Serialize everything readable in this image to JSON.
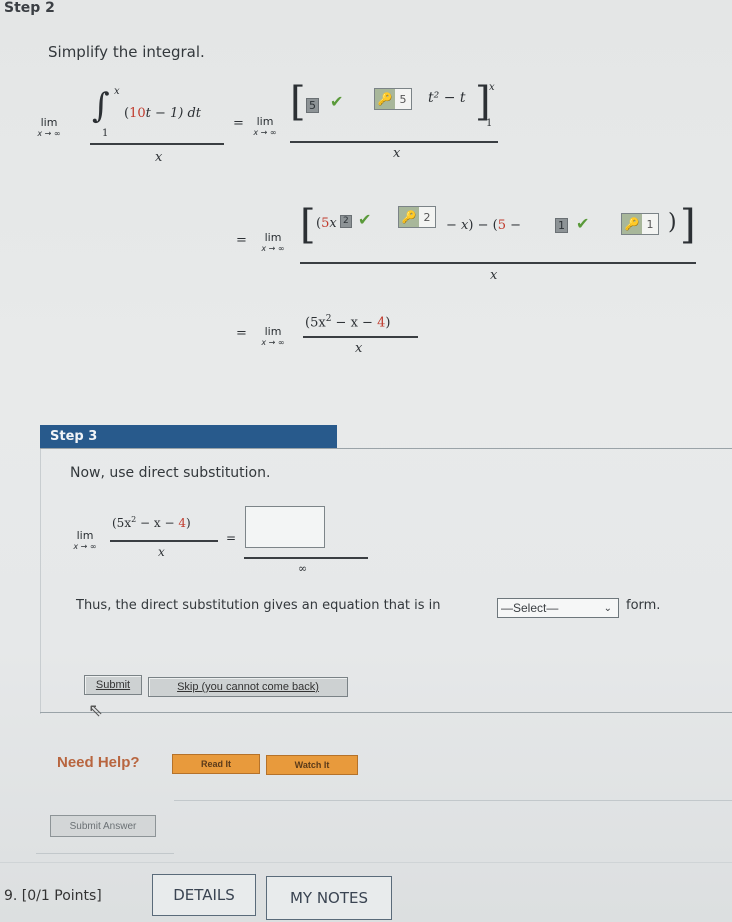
{
  "step2": {
    "label": "Step 2",
    "instruction": "Simplify the integral.",
    "line1": {
      "lim": "lim",
      "lim_sub": "x → ∞",
      "integral_sign": "∫",
      "upper_limit": "x",
      "lower_limit": "1",
      "integrand_open": "(",
      "integrand_coef": "10",
      "integrand_rest": "t − 1) dt",
      "denominator": "x",
      "equals": "=",
      "rhs_lim": "lim",
      "rhs_lim_sub": "x → ∞",
      "answer_box_1": "5",
      "answer_box_2_value": "5",
      "term_after": "t² − t",
      "bracket_upper": "x",
      "bracket_lower": "1",
      "rhs_denominator": "x"
    },
    "line2": {
      "equals": "=",
      "lim": "lim",
      "lim_sub": "x → ∞",
      "open": "(5x",
      "answer_box_exp": "2",
      "answer_box_exp_key": "2",
      "mid": "− x) − (5 −",
      "answer_box_const": "1",
      "answer_box_const_key": "1",
      "close": ")",
      "denominator": "x"
    },
    "line3": {
      "equals": "=",
      "lim": "lim",
      "lim_sub": "x → ∞",
      "numerator_a": "(5x",
      "numerator_exp": "2",
      "numerator_b": " − x − ",
      "numerator_c": "4",
      "numerator_d": ")",
      "denominator": "x"
    }
  },
  "step3": {
    "label": "Step 3",
    "instruction": "Now, use direct substitution.",
    "expr": {
      "lim": "lim",
      "lim_sub": "x → ∞",
      "numerator_a": "(5x",
      "numerator_exp": "2",
      "numerator_b": " − x − ",
      "numerator_c": "4",
      "numerator_d": ")",
      "denominator": "x",
      "equals": "=",
      "answer_value": "",
      "rhs_denominator": "∞"
    },
    "sentence_before": "Thus, the direct substitution gives an equation that is in",
    "select_value": "—Select—",
    "sentence_after": "form.",
    "submit_label": "Submit",
    "skip_label": "Skip (you cannot come back)"
  },
  "help": {
    "label": "Need Help?",
    "read_it": "Read It",
    "watch_it": "Watch It"
  },
  "submit_answer_label": "Submit Answer",
  "next_question": {
    "label": "9.  [0/1 Points]",
    "details": "DETAILS",
    "my_notes": "MY NOTES"
  },
  "colors": {
    "step_header_bg": "#285a8c",
    "highlight_red": "#c0392b",
    "check_green": "#5a9a3a",
    "help_orange": "#e89a3c",
    "need_help_text": "#b8653f"
  }
}
